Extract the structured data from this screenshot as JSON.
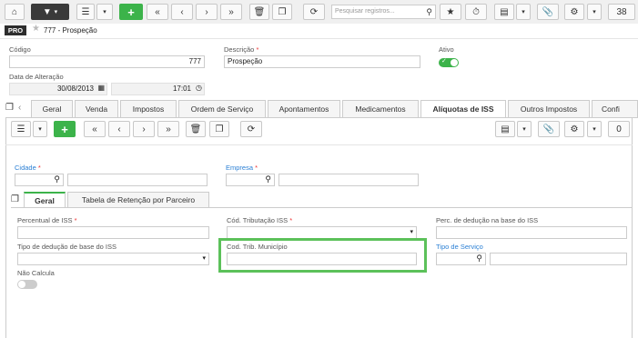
{
  "toolbar": {
    "search_placeholder": "Pesquisar registros...",
    "record_count": "38"
  },
  "header": {
    "badge": "PRO",
    "title": "777 - Prospeção"
  },
  "form": {
    "codigo_label": "Código",
    "codigo_value": "777",
    "descricao_label": "Descrição",
    "descricao_value": "Prospeção",
    "ativo_label": "Ativo",
    "data_label": "Data de Alteração",
    "data_value": "30/08/2013",
    "hora_value": "17:01"
  },
  "tabs": [
    {
      "label": "Geral"
    },
    {
      "label": "Venda"
    },
    {
      "label": "Impostos"
    },
    {
      "label": "Ordem de Serviço"
    },
    {
      "label": "Apontamentos"
    },
    {
      "label": "Medicamentos"
    },
    {
      "label": "Alíquotas de ISS"
    },
    {
      "label": "Outros Impostos"
    },
    {
      "label": "Confi"
    }
  ],
  "subtoolbar": {
    "record_count": "0"
  },
  "filters": {
    "cidade_label": "Cidade",
    "empresa_label": "Empresa"
  },
  "subtabs": [
    {
      "label": "Geral"
    },
    {
      "label": "Tabela de Retenção por Parceiro"
    }
  ],
  "fields": {
    "percentual_label": "Percentual de ISS",
    "cod_tributacao_label": "Cód. Tributação ISS",
    "perc_deducao_label": "Perc. de dedução na base do ISS",
    "tipo_deducao_label": "Tipo de dedução de base do ISS",
    "cod_trib_municipio_label": "Cod. Trib. Município",
    "tipo_servico_label": "Tipo de Serviço",
    "nao_calcula_label": "Não Calcula"
  },
  "colors": {
    "accent_green": "#3cb34a",
    "highlight_green": "#5cc15a",
    "link_blue": "#2a7fd4"
  }
}
